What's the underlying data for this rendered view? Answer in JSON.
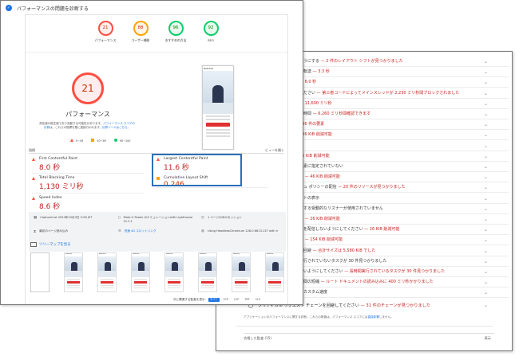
{
  "header": {
    "title": "パフォーマンスの問題を診断する"
  },
  "gauges": [
    {
      "score": "21",
      "label": "パフォーマンス",
      "color": "red"
    },
    {
      "score": "88",
      "label": "ユーザー補助",
      "color": "orange"
    },
    {
      "score": "96",
      "label": "おすすめの方法",
      "color": "green"
    },
    {
      "score": "92",
      "label": "SEO",
      "color": "green"
    }
  ],
  "performance": {
    "score": "21",
    "label": "パフォーマンス",
    "desc_pre": "測定値の推定値であり変動する可能性があります。",
    "desc_link": "パフォーマンス スコアの計算",
    "desc_mid": "は、これらの指標を基に直接行われます。",
    "desc_link2": "計算ツールはこちら。",
    "legend": [
      "0~49",
      "50~89",
      "90~100"
    ]
  },
  "metrics_header": {
    "title": "指標",
    "toggle": "ビューを開く"
  },
  "metrics": [
    {
      "name": "First Contentful Paint",
      "value": "8.0 秒",
      "status": "red"
    },
    {
      "name": "Largest Contentful Paint",
      "value": "11.6 秒",
      "status": "red"
    },
    {
      "name": "Total Blocking Time",
      "value": "1,130 ミリ秒",
      "status": "red"
    },
    {
      "name": "Cumulative Layout Shift",
      "value": "0.246",
      "status": "orange"
    },
    {
      "name": "Speed Index",
      "value": "8.6 秒",
      "status": "red"
    }
  ],
  "info": {
    "captured": "Captured at 2024年10月3日 5:56 JST",
    "device": "Moto G Power のエミュレーションwith Lighthouse 12.2.1",
    "session": "1 ページのみのセッション",
    "initial_load": "最初のページ読み込み",
    "throttling": "低速 4G スロットリング",
    "browser": "Using HeadlessChromium 128.0.6613.137 with lr"
  },
  "treemap_label": "ツリーマップを見る",
  "phone_brand": "Rakuten",
  "audits_filter": {
    "label": "次に関連する監査を表示:",
    "chips": [
      "すべて",
      "FCP",
      "LCP",
      "TBT",
      "CLS"
    ]
  },
  "diagnostics": [
    {
      "text": "ようにする",
      "hint": "— 2 件のレイアウト シフトが見つかりました"
    },
    {
      "text": "の転送",
      "hint": "— 3.3 秒"
    },
    {
      "text": "",
      "hint": "— 6.0 秒"
    },
    {
      "text": "ください",
      "hint": "— 第三者コードによってメインスレッドが 2,230 ミリ秒間ブロックされました"
    },
    {
      "text": "",
      "hint": "— 11,600 ミリ秒"
    },
    {
      "text": "の時間",
      "hint": "— 6,260 ミリ秒間確認できます"
    },
    {
      "text": "",
      "hint": "236 件の要素"
    },
    {
      "text": "",
      "hint": "536 KiB 削減可能"
    },
    {
      "text": "",
      "hint": "を"
    },
    {
      "text": "",
      "hint": "36 KiB 削減可能"
    },
    {
      "text": "要素に指定されていない",
      "hint": ""
    },
    {
      "text": "縮",
      "hint": "— 46 KiB 削減可能"
    },
    {
      "text": "シュ ポリシーの配信",
      "hint": "— 20 件のリソースが見つかりました"
    },
    {
      "text": "ストの表示",
      "hint": ""
    },
    {
      "text": "にする受動的なリスナーが使用されていません",
      "hint": ""
    },
    {
      "text": "ル",
      "hint": "— 26 KiB 削減可能"
    },
    {
      "text": "みを配信しないようにしてください",
      "hint": "— 26 KiB 削減可能"
    },
    {
      "text": "り",
      "hint": "— 154 KiB 削減可能"
    },
    {
      "text": "の回避",
      "hint": "— 合計サイズは 5,580 KiB でした"
    },
    {
      "text": "実行されていないタスクが 30 件見つかりました",
      "hint": ""
    },
    {
      "text": "ないようにしてください",
      "hint": "— 長時間実行されているタスクが 30 件見つかりました"
    },
    {
      "text": "時間の短縮",
      "hint": "— ルート ドキュメントの読み込みに 400 ミリ秒かかりました"
    },
    {
      "text": "のカスタム速度",
      "hint": ""
    }
  ],
  "critical_chain": {
    "text": "クリティカル リクエスト チェーンを回避してください",
    "hint": "— 31 件のチェーンが見つかりました"
  },
  "footnote": {
    "text": "アプリケーションのパフォーマンスに関する診断。これらの数値は、パフォーマンス スコアには",
    "link": "直接影響",
    "tail": "しません。"
  },
  "passed": {
    "label": "合格した監査 (15)",
    "toggle": "表示"
  }
}
